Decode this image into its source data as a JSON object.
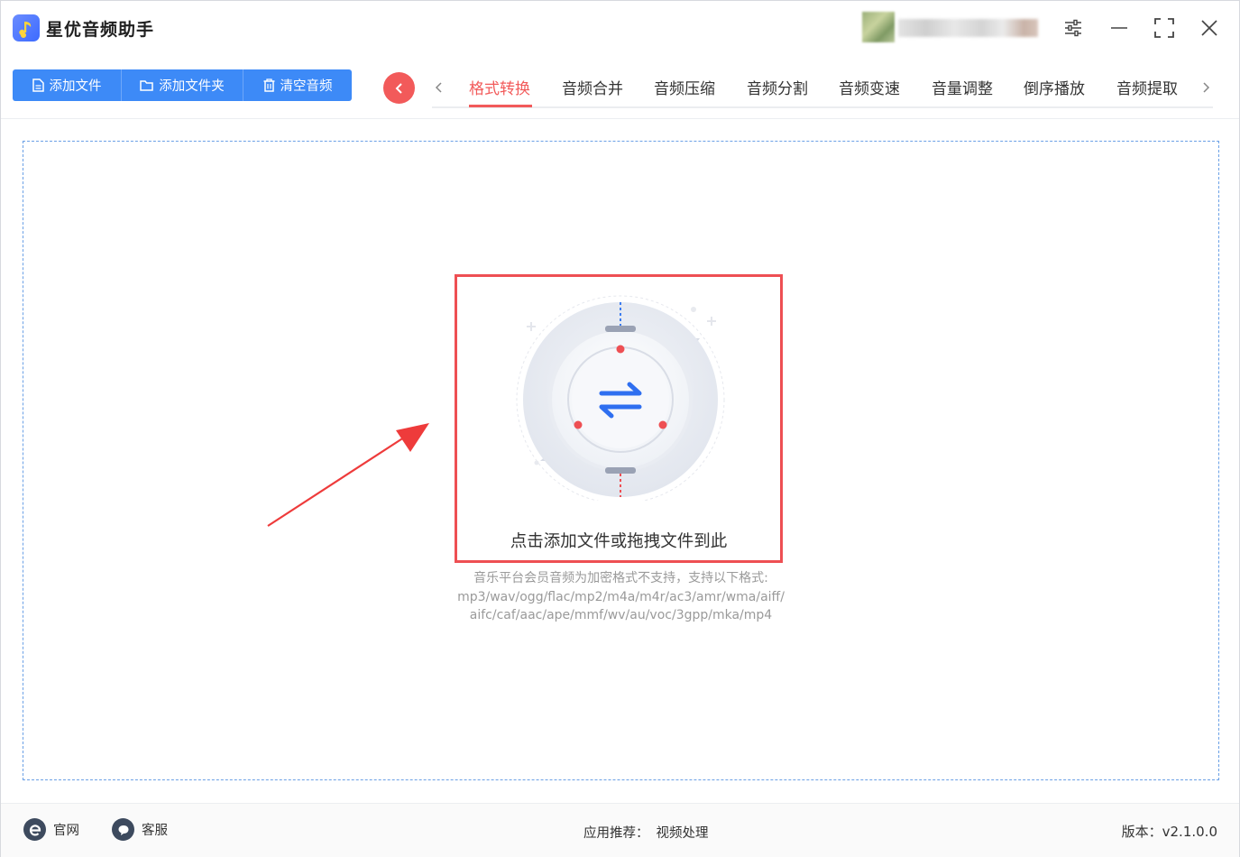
{
  "app": {
    "title": "星优音频助手",
    "accent_color": "#f25a5a",
    "primary_color": "#3d8af7"
  },
  "window_controls": {
    "settings_icon": "sliders-icon",
    "minimize_icon": "minimize-icon",
    "maximize_icon": "maximize-icon",
    "close_icon": "close-icon"
  },
  "toolbar": {
    "add_file": "添加文件",
    "add_folder": "添加文件夹",
    "clear_audio": "清空音频"
  },
  "tabs": [
    {
      "label": "格式转换",
      "active": true
    },
    {
      "label": "音频合并"
    },
    {
      "label": "音频压缩"
    },
    {
      "label": "音频分割"
    },
    {
      "label": "音频变速"
    },
    {
      "label": "音量调整"
    },
    {
      "label": "倒序播放"
    },
    {
      "label": "音频提取"
    }
  ],
  "dropzone": {
    "prompt": "点击添加文件或拖拽文件到此",
    "note_line1": "音乐平台会员音频为加密格式不支持，支持以下格式:",
    "note_line2": "mp3/wav/ogg/flac/mp2/m4a/m4r/ac3/amr/wma/aiff/",
    "note_line3": "aifc/caf/aac/ape/mmf/wv/au/voc/3gpp/mka/mp4"
  },
  "footer": {
    "website": "官网",
    "support": "客服",
    "recommend_label": "应用推荐：",
    "recommend_link": "视频处理",
    "version": "版本：v2.1.0.0"
  }
}
